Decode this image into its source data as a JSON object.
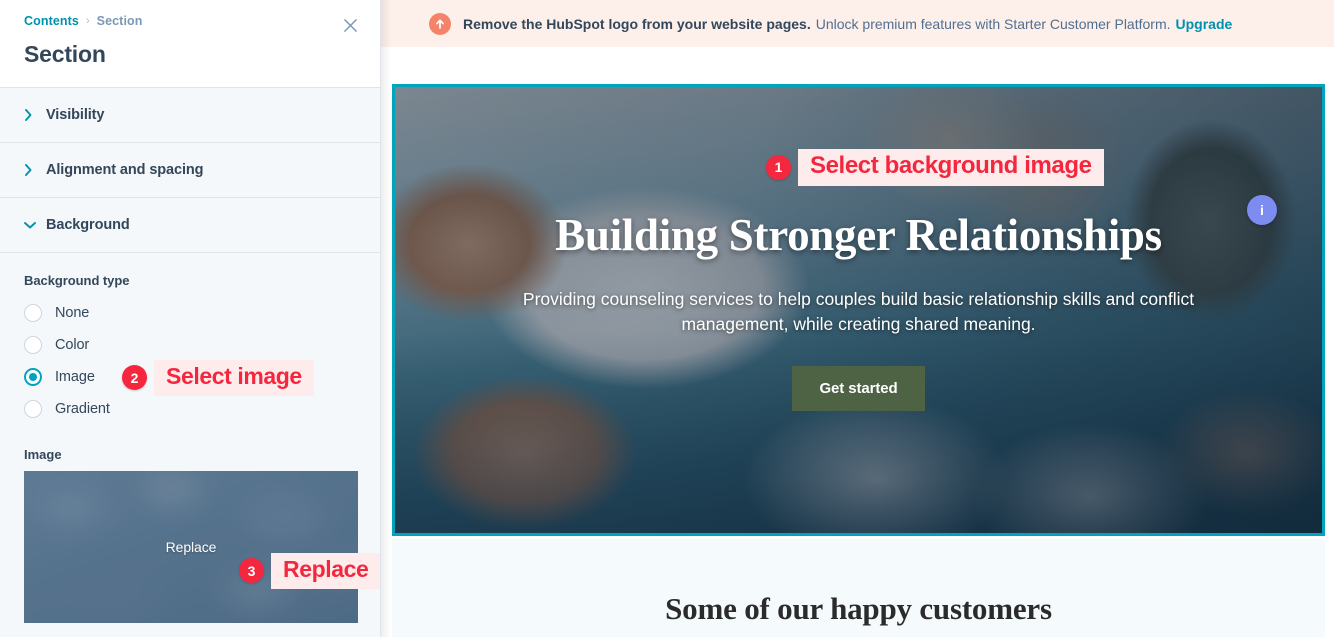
{
  "sidebar": {
    "breadcrumb": {
      "parent": "Contents",
      "separator": "›",
      "current": "Section"
    },
    "title": "Section",
    "close_label": "close-icon",
    "accordions": [
      {
        "label": "Visibility",
        "expanded": false
      },
      {
        "label": "Alignment and spacing",
        "expanded": false
      },
      {
        "label": "Background",
        "expanded": true
      }
    ],
    "background_panel": {
      "type_label": "Background type",
      "options": [
        {
          "label": "None",
          "selected": false
        },
        {
          "label": "Color",
          "selected": false
        },
        {
          "label": "Image",
          "selected": true
        },
        {
          "label": "Gradient",
          "selected": false
        }
      ],
      "image_label": "Image",
      "image_replace_text": "Replace"
    }
  },
  "notice": {
    "icon": "upgrade-arrow-icon",
    "strong": "Remove the HubSpot logo from your website pages.",
    "rest": "Unlock premium features with Starter Customer Platform.",
    "link": "Upgrade"
  },
  "preview": {
    "hero": {
      "heading": "Building Stronger Relationships",
      "paragraph": "Providing counseling services to help couples build basic relationship skills and conflict management, while creating shared meaning.",
      "cta": "Get started",
      "info_badge": "i",
      "selection_color": "#00a4bd"
    },
    "lower_section": {
      "heading": "Some of our happy customers"
    }
  },
  "annotations": [
    {
      "number": "1",
      "text": "Select background image"
    },
    {
      "number": "2",
      "text": "Select image"
    },
    {
      "number": "3",
      "text": "Replace"
    }
  ],
  "colors": {
    "accent_teal": "#00a4bd",
    "link_teal": "#0091ae",
    "text_dark": "#33475b",
    "annotation_red": "#f5273f",
    "annotation_bg": "#fdeceb",
    "notice_bg": "#fdf0eb",
    "cta_green": "#4e6244",
    "sidebar_bg": "#f5f8fa"
  }
}
